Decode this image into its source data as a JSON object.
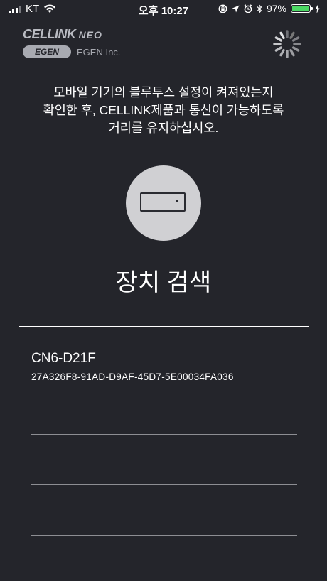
{
  "status_bar": {
    "carrier": "KT",
    "time": "오후 10:27",
    "battery_percent": "97%",
    "battery_level": 0.97,
    "icons": [
      "signal-icon",
      "wifi-icon",
      "rotation-lock-icon",
      "location-icon",
      "alarm-icon",
      "bluetooth-icon",
      "battery-icon",
      "charging-icon"
    ]
  },
  "header": {
    "logo": "CELLINK",
    "logo_suffix": "NEO",
    "company_badge": "EGEN",
    "company_name": "EGEN Inc."
  },
  "instruction": "모바일 기기의 블루투스 설정이 켜져있는지\n확인한 후, CELLINK제품과 통신이 가능하도록\n거리를 유지하십시오.",
  "title": "장치 검색",
  "devices": [
    {
      "name": "CN6-D21F",
      "id": "27A326F8-91AD-D9AF-45D7-5E00034FA036"
    }
  ],
  "colors": {
    "background": "#24252b",
    "text": "#ffffff",
    "battery": "#4cd964",
    "separator": "#8d8e93",
    "device_circle": "#d0d0d3"
  }
}
